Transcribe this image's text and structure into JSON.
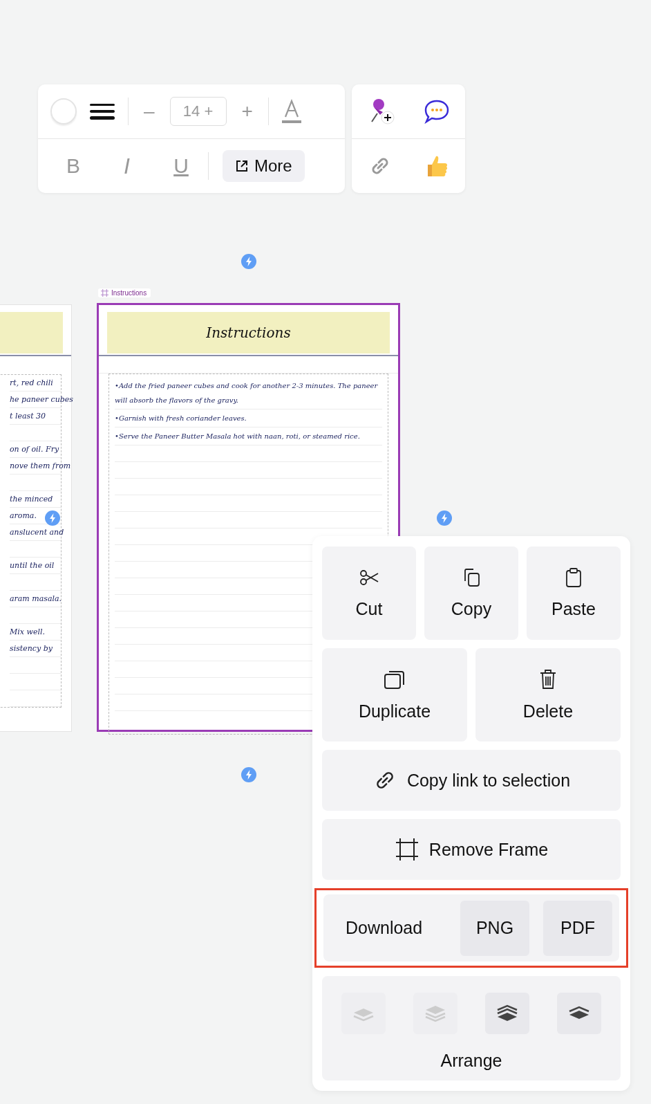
{
  "format_toolbar": {
    "font_size": "14 +",
    "minus": "–",
    "plus": "+",
    "styles": [
      {
        "kind": "bold",
        "label": "B"
      },
      {
        "kind": "italic",
        "label": "I"
      },
      {
        "kind": "underline",
        "label": "U"
      }
    ],
    "more": "More"
  },
  "collab_toolbar": {
    "items": [
      {
        "kind": "pin"
      },
      {
        "kind": "comment"
      },
      {
        "kind": "link"
      },
      {
        "kind": "thumb"
      }
    ]
  },
  "left_frame": {
    "paragraphs": [
      [
        "rt, red chili",
        "he paneer cubes",
        "t least 30"
      ],
      [
        "on of oil. Fry",
        "nove them from"
      ],
      [
        "the minced",
        "aroma.",
        "anslucent and"
      ],
      [
        "until the oil"
      ],
      [
        "aram masala."
      ],
      [
        "Mix well.",
        "sistency by"
      ]
    ]
  },
  "instructions_frame": {
    "label": "Instructions",
    "title": "Instructions",
    "lines": [
      "•Add the fried paneer cubes and cook for another 2-3 minutes. The paneer will absorb the flavors of the gravy.",
      "•Garnish with fresh coriander leaves.",
      "•Serve the Paneer Butter Masala hot with naan, roti, or steamed rice."
    ]
  },
  "context_menu": {
    "top_row": [
      {
        "kind": "cut",
        "label": "Cut"
      },
      {
        "kind": "copy",
        "label": "Copy"
      },
      {
        "kind": "paste",
        "label": "Paste"
      }
    ],
    "second_row": [
      {
        "kind": "duplicate",
        "label": "Duplicate"
      },
      {
        "kind": "delete",
        "label": "Delete"
      }
    ],
    "copy_link": "Copy link to selection",
    "remove_frame": "Remove Frame",
    "download": {
      "label": "Download",
      "formats": [
        "PNG",
        "PDF"
      ],
      "highlighted": true
    },
    "arrange": {
      "label": "Arrange",
      "buttons": [
        {
          "kind": "backward",
          "disabled": true
        },
        {
          "kind": "to_back",
          "disabled": true
        },
        {
          "kind": "to_front",
          "disabled": false
        },
        {
          "kind": "forward",
          "disabled": false
        }
      ]
    }
  }
}
